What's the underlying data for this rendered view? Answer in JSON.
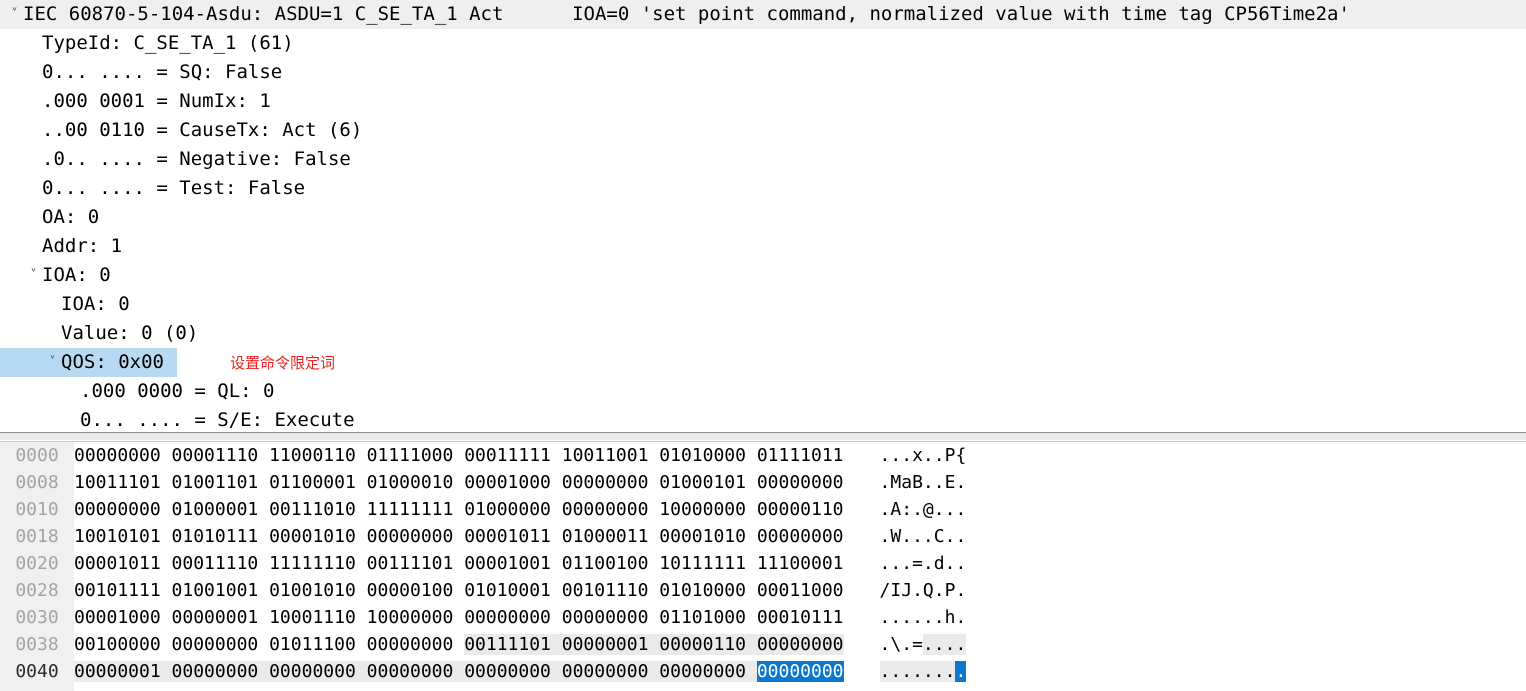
{
  "app": {
    "kind": "packet-analyzer-detail-and-bytes-panes"
  },
  "colors": {
    "selection_blue": "#0b78d0",
    "row_select_blue": "#b8d9f2",
    "row_hover_gray": "#efefef",
    "field_highlight_gray": "#eaeaea",
    "annotation_red": "#ef2020",
    "offset_gutter_bg": "#f0f0f0",
    "offset_text_gray": "#a0a4a8"
  },
  "detail_tree": {
    "rows": [
      {
        "twisty": "˅",
        "indent": 0,
        "text": "IEC 60870-5-104-Asdu: ASDU=1 C_SE_TA_1 Act      IOA=0 'set point command, normalized value with time tag CP56Time2a'",
        "state": "hover",
        "note": ""
      },
      {
        "twisty": "",
        "indent": 1,
        "text": "TypeId: C_SE_TA_1 (61)",
        "state": "normal",
        "note": ""
      },
      {
        "twisty": "",
        "indent": 1,
        "text": "0... .... = SQ: False",
        "state": "normal",
        "note": ""
      },
      {
        "twisty": "",
        "indent": 1,
        "text": ".000 0001 = NumIx: 1",
        "state": "normal",
        "note": ""
      },
      {
        "twisty": "",
        "indent": 1,
        "text": "..00 0110 = CauseTx: Act (6)",
        "state": "normal",
        "note": ""
      },
      {
        "twisty": "",
        "indent": 1,
        "text": ".0.. .... = Negative: False",
        "state": "normal",
        "note": ""
      },
      {
        "twisty": "",
        "indent": 1,
        "text": "0... .... = Test: False",
        "state": "normal",
        "note": ""
      },
      {
        "twisty": "",
        "indent": 1,
        "text": "OA: 0",
        "state": "normal",
        "note": ""
      },
      {
        "twisty": "",
        "indent": 1,
        "text": "Addr: 1",
        "state": "normal",
        "note": ""
      },
      {
        "twisty": "˅",
        "indent": 1,
        "text": "IOA: 0",
        "state": "normal",
        "note": ""
      },
      {
        "twisty": "",
        "indent": 2,
        "text": "IOA: 0",
        "state": "normal",
        "note": ""
      },
      {
        "twisty": "",
        "indent": 2,
        "text": "Value: 0 (0)",
        "state": "normal",
        "note": ""
      },
      {
        "twisty": "˅",
        "indent": 2,
        "text": "QOS: 0x00",
        "state": "selected",
        "note": "设置命令限定词"
      },
      {
        "twisty": "",
        "indent": 3,
        "text": ".000 0000 = QL: 0",
        "state": "normal",
        "note": ""
      },
      {
        "twisty": "",
        "indent": 3,
        "text": "0... .... = S/E: Execute",
        "state": "normal",
        "note": ""
      }
    ]
  },
  "hex_pane": {
    "rows": [
      {
        "offset": "0000",
        "bytes": [
          "00000000",
          "00001110",
          "11000110",
          "01111000",
          "00011111",
          "10011001",
          "01010000",
          "01111011"
        ],
        "ascii": "...x..P{",
        "current": false,
        "field_from": -1,
        "field_to": -1,
        "sel_index": -1
      },
      {
        "offset": "0008",
        "bytes": [
          "10011101",
          "01001101",
          "01100001",
          "01000010",
          "00001000",
          "00000000",
          "01000101",
          "00000000"
        ],
        "ascii": ".MaB..E.",
        "current": false,
        "field_from": -1,
        "field_to": -1,
        "sel_index": -1
      },
      {
        "offset": "0010",
        "bytes": [
          "00000000",
          "01000001",
          "00111010",
          "11111111",
          "01000000",
          "00000000",
          "10000000",
          "00000110"
        ],
        "ascii": ".A:.@...",
        "current": false,
        "field_from": -1,
        "field_to": -1,
        "sel_index": -1
      },
      {
        "offset": "0018",
        "bytes": [
          "10010101",
          "01010111",
          "00001010",
          "00000000",
          "00001011",
          "01000011",
          "00001010",
          "00000000"
        ],
        "ascii": ".W...C..",
        "current": false,
        "field_from": -1,
        "field_to": -1,
        "sel_index": -1
      },
      {
        "offset": "0020",
        "bytes": [
          "00001011",
          "00011110",
          "11111110",
          "00111101",
          "00001001",
          "01100100",
          "10111111",
          "11100001"
        ],
        "ascii": "...=.d..",
        "current": false,
        "field_from": -1,
        "field_to": -1,
        "sel_index": -1
      },
      {
        "offset": "0028",
        "bytes": [
          "00101111",
          "01001001",
          "01001010",
          "00000100",
          "01010001",
          "00101110",
          "01010000",
          "00011000"
        ],
        "ascii": "/IJ.Q.P.",
        "current": false,
        "field_from": -1,
        "field_to": -1,
        "sel_index": -1
      },
      {
        "offset": "0030",
        "bytes": [
          "00001000",
          "00000001",
          "10001110",
          "10000000",
          "00000000",
          "00000000",
          "01101000",
          "00010111"
        ],
        "ascii": "......h.",
        "current": false,
        "field_from": -1,
        "field_to": -1,
        "sel_index": -1
      },
      {
        "offset": "0038",
        "bytes": [
          "00100000",
          "00000000",
          "01011100",
          "00000000",
          "00111101",
          "00000001",
          "00000110",
          "00000000"
        ],
        "ascii": ".\\.=...",
        "current": false,
        "field_from": 4,
        "field_to": 7,
        "sel_index": -1
      },
      {
        "offset": "0040",
        "bytes": [
          "00000001",
          "00000000",
          "00000000",
          "00000000",
          "00000000",
          "00000000",
          "00000000",
          "00000000"
        ],
        "ascii": "........",
        "current": true,
        "field_from": 0,
        "field_to": 6,
        "sel_index": 7
      }
    ]
  }
}
